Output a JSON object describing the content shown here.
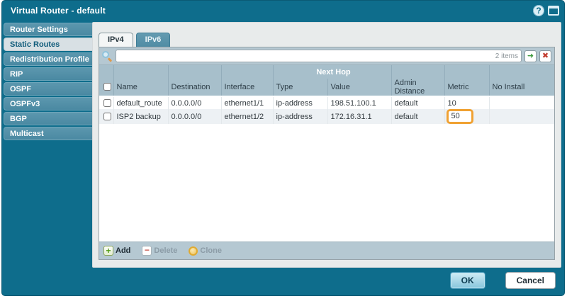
{
  "colors": {
    "frame_teal": "#0E6D8C",
    "header_blue": "#A7BFCB",
    "toolbar_blue": "#B5C8D2",
    "highlight_orange": "#F0A132",
    "row_alt": "#EDF1F4"
  },
  "dialog": {
    "title": "Virtual Router - default"
  },
  "titlebar": {
    "help_glyph": "?"
  },
  "sidebar": {
    "items": [
      {
        "label": "Router Settings"
      },
      {
        "label": "Static Routes"
      },
      {
        "label": "Redistribution Profile"
      },
      {
        "label": "RIP"
      },
      {
        "label": "OSPF"
      },
      {
        "label": "OSPFv3"
      },
      {
        "label": "BGP"
      },
      {
        "label": "Multicast"
      }
    ]
  },
  "tabs": {
    "ipv4": "IPv4",
    "ipv6": "IPv6"
  },
  "filter": {
    "value": "",
    "count": "2 items",
    "apply_glyph": "➜",
    "clear_glyph": "✖"
  },
  "table": {
    "group_header": "Next Hop",
    "columns": {
      "name": "Name",
      "destination": "Destination",
      "interface": "Interface",
      "type": "Type",
      "value": "Value",
      "admin_distance": "Admin Distance",
      "metric": "Metric",
      "no_install": "No Install"
    },
    "rows": [
      {
        "name": "default_route",
        "destination": "0.0.0.0/0",
        "interface": "ethernet1/1",
        "type": "ip-address",
        "value": "198.51.100.1",
        "admin_distance": "default",
        "metric": "10",
        "no_install": ""
      },
      {
        "name": "ISP2 backup",
        "destination": "0.0.0.0/0",
        "interface": "ethernet1/2",
        "type": "ip-address",
        "value": "172.16.31.1",
        "admin_distance": "default",
        "metric": "50",
        "no_install": ""
      }
    ]
  },
  "toolbar": {
    "add_label": "Add",
    "add_glyph": "+",
    "delete_label": "Delete",
    "delete_glyph": "−",
    "clone_label": "Clone"
  },
  "footer": {
    "ok_label": "OK",
    "cancel_label": "Cancel"
  }
}
